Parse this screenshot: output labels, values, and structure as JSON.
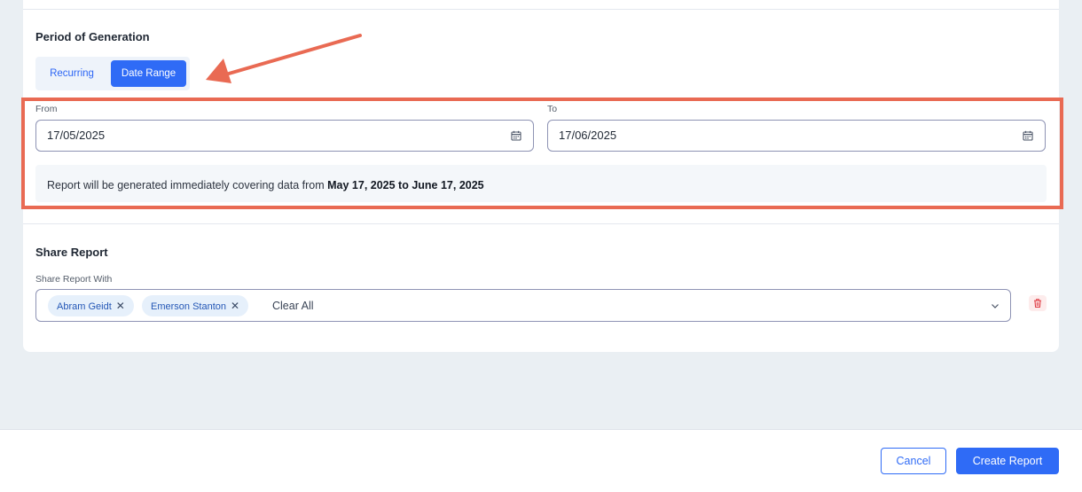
{
  "period": {
    "title": "Period of Generation",
    "toggle": {
      "recurring_label": "Recurring",
      "date_range_label": "Date Range",
      "active": "Date Range"
    },
    "from": {
      "label": "From",
      "value": "17/05/2025"
    },
    "to": {
      "label": "To",
      "value": "17/06/2025"
    },
    "summary": {
      "prefix": "Report will be generated immediately covering data from ",
      "range": "May 17, 2025 to June 17, 2025"
    }
  },
  "share": {
    "title": "Share Report",
    "field_label": "Share Report With",
    "chips": [
      {
        "name": "Abram Geidt",
        "remove_glyph": "✕"
      },
      {
        "name": "Emerson Stanton",
        "remove_glyph": "✕"
      }
    ],
    "clear_all_label": "Clear All"
  },
  "footer": {
    "cancel_label": "Cancel",
    "create_label": "Create Report"
  },
  "icons": {
    "date_picker": "calendar-icon",
    "dropdown": "chevron-down-icon",
    "delete": "trash-icon",
    "annotation": "arrow-annotation"
  },
  "colors": {
    "primary": "#2f6bf6",
    "annotation": "#e96a53",
    "chip_bg": "#e6f0fb",
    "danger_bg": "#fdecec",
    "danger": "#e0424a"
  }
}
